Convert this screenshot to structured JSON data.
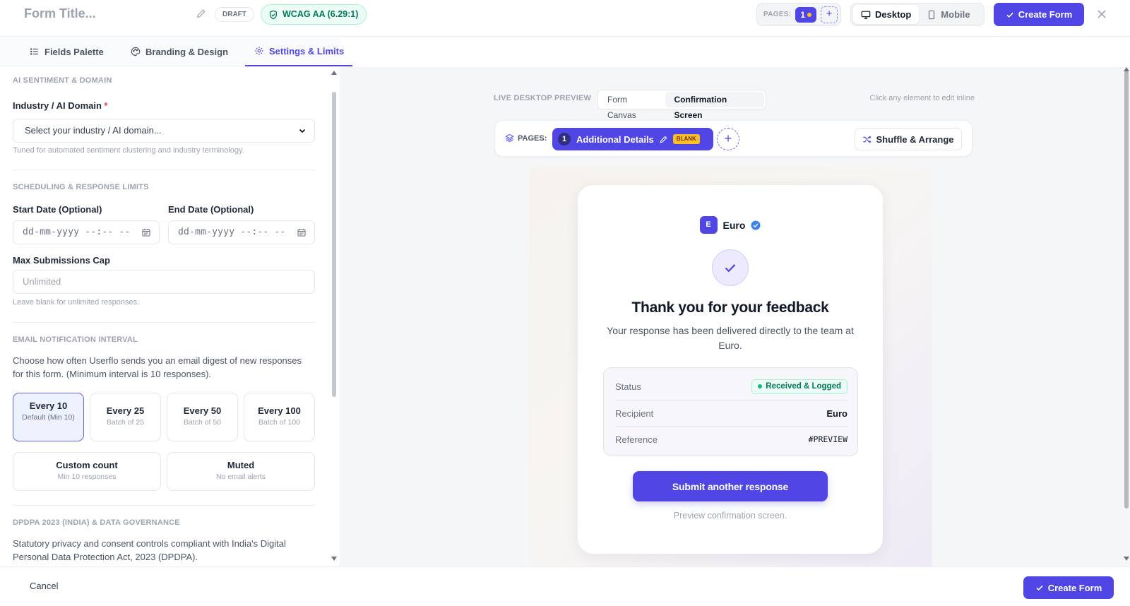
{
  "header": {
    "form_title": "Form Title...",
    "status_badge": "DRAFT",
    "wcag_badge": "WCAG AA (6.29:1)",
    "pages_label": "PAGES:",
    "pages_current": "1",
    "pages_add": "+",
    "device_options": [
      "Desktop",
      "Mobile"
    ],
    "device_selected": "Desktop",
    "create_label": "Create Form",
    "close_icon": "close-icon"
  },
  "tabs": [
    {
      "label": "Fields Palette",
      "icon": "list-icon"
    },
    {
      "label": "Branding & Design",
      "icon": "palette-icon"
    },
    {
      "label": "Settings & Limits",
      "icon": "gear-icon",
      "active": true
    }
  ],
  "settings": {
    "ai_section": {
      "title": "AI SENTIMENT & DOMAIN",
      "industry_label": "Industry / AI Domain",
      "required_mark": "*",
      "industry_select_value": "Select your industry / AI domain...",
      "industry_helper": "Tuned for automated sentiment clustering and industry terminology."
    },
    "schedule_section": {
      "title": "SCHEDULING & RESPONSE LIMITS",
      "start_label": "Start Date (Optional)",
      "end_label": "End Date (Optional)",
      "date_placeholder": "dd-mm-yyyy --:-- --",
      "max_label": "Max Submissions Cap",
      "max_placeholder": "Unlimited",
      "max_helper": "Leave blank for unlimited responses."
    },
    "email_section": {
      "title": "EMAIL NOTIFICATION INTERVAL",
      "description": "Choose how often Userflo sends you an email digest of new responses for this form. (Minimum interval is 10 responses).",
      "options": [
        {
          "title": "Every 10",
          "sub": "Default (Min 10)",
          "selected": true
        },
        {
          "title": "Every 25",
          "sub": "Batch of 25"
        },
        {
          "title": "Every 50",
          "sub": "Batch of 50"
        },
        {
          "title": "Every 100",
          "sub": "Batch of 100"
        },
        {
          "title": "Custom count",
          "sub": "Min 10 responses"
        },
        {
          "title": "Muted",
          "sub": "No email alerts"
        }
      ]
    },
    "dpdpa_section": {
      "title": "DPDPA 2023 (INDIA) & DATA GOVERNANCE",
      "description": "Statutory privacy and consent controls compliant with India's Digital Personal Data Protection Act, 2023 (DPDPA)."
    }
  },
  "preview": {
    "live_label": "LIVE DESKTOP PREVIEW",
    "canvas_tabs": [
      "Form Canvas",
      "Confirmation Screen"
    ],
    "canvas_selected": "Confirmation Screen",
    "hint": "Click any element to edit inline",
    "pages_label": "PAGES:",
    "page_chip": {
      "num": "1",
      "name": "Additional Details",
      "badge": "BLANK"
    },
    "add_page": "+",
    "shuffle_label": "Shuffle & Arrange",
    "card": {
      "brand_initial": "E",
      "brand_name": "Euro",
      "title": "Thank you for your feedback",
      "message": "Your response has been delivered directly to the team at Euro.",
      "status_rows": [
        {
          "key": "Status",
          "value": "Received & Logged"
        },
        {
          "key": "Recipient",
          "value": "Euro"
        },
        {
          "key": "Reference",
          "value": "#PREVIEW"
        }
      ],
      "submit_label": "Submit another response",
      "note": "Preview confirmation screen."
    }
  },
  "footer": {
    "cancel_label": "Cancel",
    "create_label": "Create Form"
  },
  "colors": {
    "accent": "#4f46e5",
    "success": "#047857",
    "warning": "#fbbf24"
  }
}
